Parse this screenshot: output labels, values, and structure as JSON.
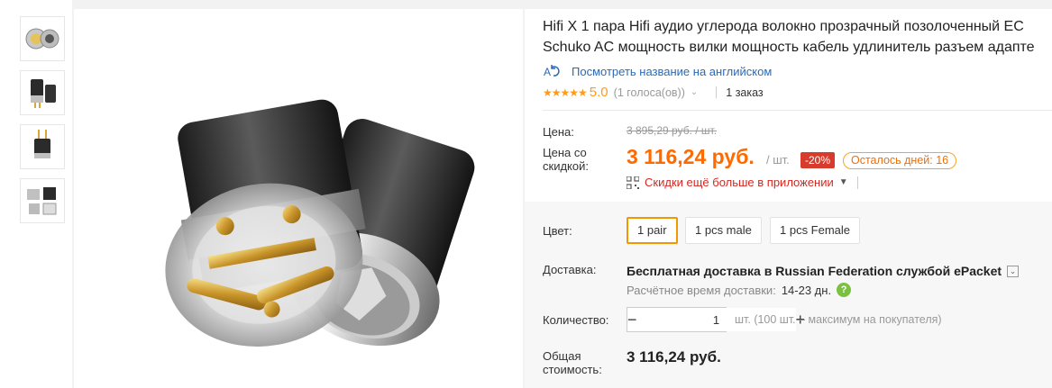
{
  "product": {
    "title_line1": "Hifi X 1 пара Hifi аудио углерода волокно прозрачный позолоченный EC",
    "title_line2": "Schuko AC мощность вилки мощность кабель удлинитель разъем адапте",
    "translate_link": "Посмотреть название на английском",
    "translate_icon": "translate-icon",
    "rating": {
      "stars": "★★★★★",
      "value": "5.0",
      "votes": "(1 голоса(ов))",
      "orders": "1 заказ"
    }
  },
  "price": {
    "label": "Цена:",
    "old": "3 895,29 руб. / шт.",
    "discount_label": "Цена со скидкой:",
    "new": "3 116,24 руб.",
    "unit": "/ шт.",
    "discount_badge": "-20%",
    "days_left": "Осталось дней: 16",
    "app_promo": "Скидки ещё больше в приложении"
  },
  "options": {
    "label": "Цвет:",
    "items": [
      "1 pair",
      "1 pcs male",
      "1 pcs Female"
    ],
    "selected": "1 pair"
  },
  "shipping": {
    "label": "Доставка:",
    "main": "Бесплатная доставка в Russian Federation службой ePacket",
    "time_label": "Расчётное время доставки:",
    "time_value": "14-23 дн."
  },
  "quantity": {
    "label": "Количество:",
    "value": "1",
    "minus": "−",
    "plus": "+",
    "note": "шт. (100 шт. – максимум на покупателя)"
  },
  "total": {
    "label": "Общая стоимость:",
    "value": "3 116,24 руб."
  },
  "colors": {
    "accent": "#ff6a00",
    "badge": "#d63b2c",
    "link": "#2a6ab8",
    "promo": "#d6271f",
    "selected_border": "#f29700"
  }
}
